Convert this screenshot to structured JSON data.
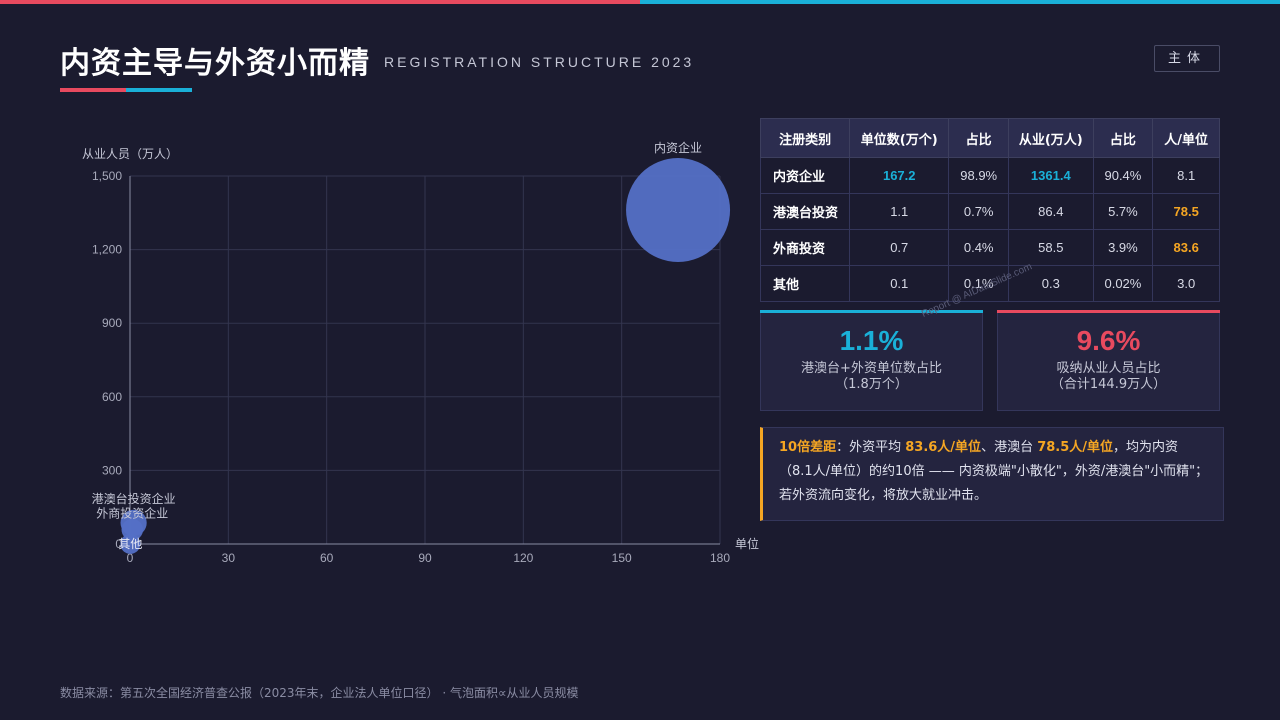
{
  "header": {
    "title": "内资主导与外资小而精",
    "subtitle": "REGISTRATION STRUCTURE 2023",
    "tag": "主体"
  },
  "chart_data": {
    "type": "scatter",
    "xlabel": "单位",
    "ylabel": "从业人员（万人）",
    "xlim": [
      0,
      180
    ],
    "ylim": [
      0,
      1500
    ],
    "xticks": [
      "0",
      "30",
      "60",
      "90",
      "120",
      "150",
      "180"
    ],
    "yticks": [
      "0",
      "300",
      "600",
      "900",
      "1,200",
      "1,500"
    ],
    "points": [
      {
        "label": "内资企业",
        "x": 167.2,
        "y": 1361.4
      },
      {
        "label": "港澳台投资企业",
        "x": 1.1,
        "y": 86.4
      },
      {
        "label": "外商投资企业",
        "x": 0.7,
        "y": 58.5
      },
      {
        "label": "其他",
        "x": 0.1,
        "y": 0.3
      }
    ],
    "bubble_color": "#5470c6",
    "grid": true
  },
  "table": {
    "headers": [
      "注册类别",
      "单位数(万个)",
      "占比",
      "从业(万人)",
      "占比",
      "人/单位"
    ],
    "rows": [
      [
        "内资企业",
        "167.2",
        "98.9%",
        "1361.4",
        "90.4%",
        "8.1"
      ],
      [
        "港澳台投资",
        "1.1",
        "0.7%",
        "86.4",
        "5.7%",
        "78.5"
      ],
      [
        "外商投资",
        "0.7",
        "0.4%",
        "58.5",
        "3.9%",
        "83.6"
      ],
      [
        "其他",
        "0.1",
        "0.1%",
        "0.3",
        "0.02%",
        "3.0"
      ]
    ]
  },
  "cards": [
    {
      "value": "1.1%",
      "line1": "港澳台+外资单位数占比",
      "line2": "（1.8万个）",
      "color": "#1ab0d8"
    },
    {
      "value": "9.6%",
      "line1": "吸纳从业人员占比",
      "line2": "（合计144.9万人）",
      "color": "#e84a5f"
    }
  ],
  "note": {
    "lead": "10倍差距",
    "t1": "：外资平均 ",
    "b1": "83.6人/单位",
    "t2": "、港澳台 ",
    "b2": "78.5人/单位",
    "t3": "，均为内资（8.1人/单位）的约10倍 —— 内资极端\"小散化\"，外资/港澳台\"小而精\"；若外资流向变化，将放大就业冲击。"
  },
  "watermark": "Report @ AIDataSlide.com",
  "footer": "数据来源：第五次全国经济普查公报（2023年末，企业法人单位口径） · 气泡面积∝从业人员规模"
}
